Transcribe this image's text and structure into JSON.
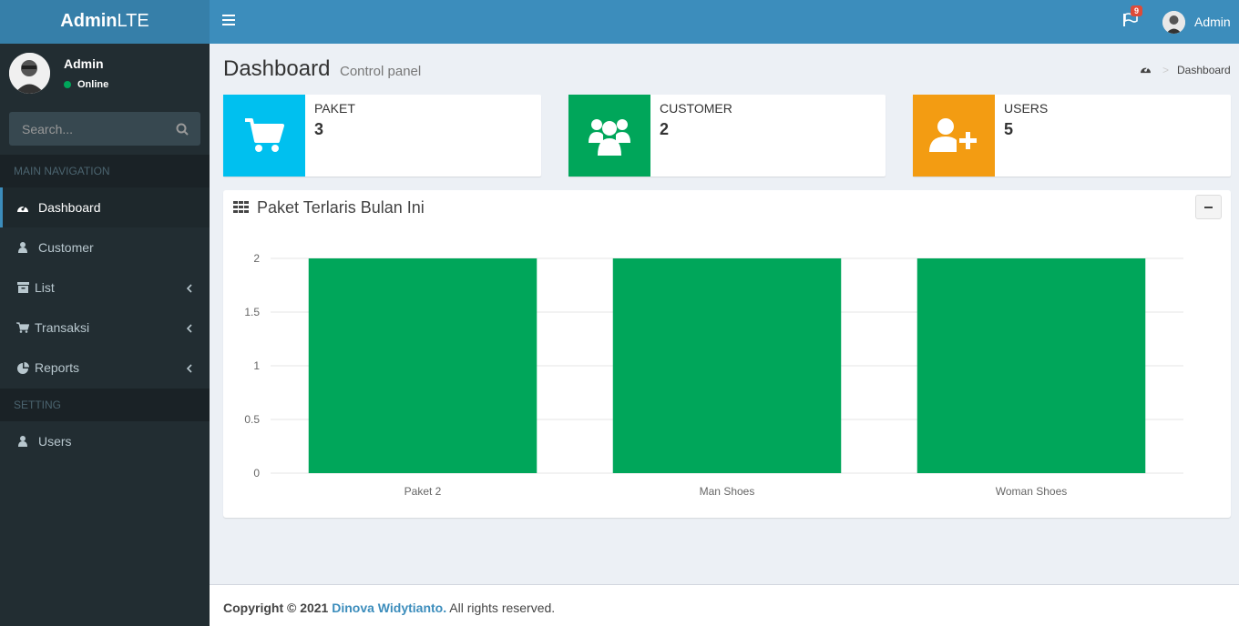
{
  "app": {
    "logo_bold": "Admin",
    "logo_rest": "LTE"
  },
  "topbar": {
    "notification_count": "9",
    "user_name": "Admin"
  },
  "sidebar": {
    "user": {
      "name": "Admin",
      "status": "Online"
    },
    "search_placeholder": "Search...",
    "section_main": "MAIN NAVIGATION",
    "section_setting": "SETTING",
    "items": [
      {
        "label": "Dashboard",
        "icon": "dashboard-icon"
      },
      {
        "label": "Customer",
        "icon": "user-icon"
      },
      {
        "label": "List",
        "icon": "archive-icon"
      },
      {
        "label": "Transaksi",
        "icon": "cart-icon"
      },
      {
        "label": "Reports",
        "icon": "pie-chart-icon"
      },
      {
        "label": "Users",
        "icon": "user-icon"
      }
    ]
  },
  "header": {
    "title": "Dashboard",
    "subtitle": "Control panel",
    "breadcrumb": "Dashboard"
  },
  "info_boxes": [
    {
      "label": "PAKET",
      "value": "3",
      "color": "#00c0ef",
      "icon": "cart-icon"
    },
    {
      "label": "CUSTOMER",
      "value": "2",
      "color": "#00a65a",
      "icon": "users-icon"
    },
    {
      "label": "USERS",
      "value": "5",
      "color": "#f39c12",
      "icon": "user-plus-icon"
    }
  ],
  "chart_box": {
    "title": "Paket Terlaris Bulan Ini"
  },
  "chart_data": {
    "type": "bar",
    "categories": [
      "Paket 2",
      "Man Shoes",
      "Woman Shoes"
    ],
    "values": [
      2,
      2,
      2
    ],
    "ylim": [
      0,
      2
    ],
    "yticks": [
      0,
      0.5,
      1,
      1.5,
      2
    ],
    "color": "#00a65a",
    "grid": true
  },
  "footer": {
    "copyright": "Copyright © 2021",
    "author": "Dinova Widytianto.",
    "rights": "All rights reserved."
  }
}
